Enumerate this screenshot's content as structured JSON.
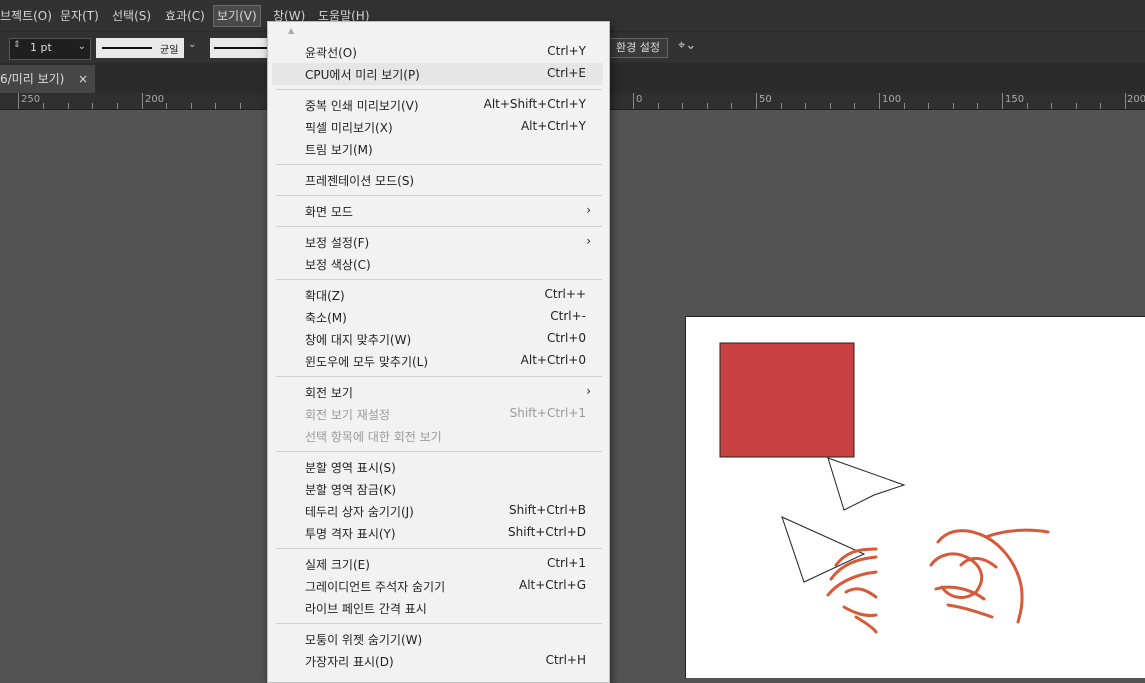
{
  "menubar": {
    "items": [
      "브젝트(O)",
      "문자(T)",
      "선택(S)",
      "효과(C)",
      "보기(V)",
      "창(W)",
      "도움말(H)"
    ]
  },
  "toolbar": {
    "stroke_weight": "1 pt",
    "stroke_profile": "균일",
    "preferences_button": "환경 설정"
  },
  "document_tab": {
    "title": "6/미리 보기)",
    "close": "×"
  },
  "ruler": {
    "labels": [
      "250",
      "200",
      "0",
      "50",
      "100",
      "150",
      "200"
    ]
  },
  "view_menu": {
    "sections": [
      [
        {
          "label": "윤곽선(O)",
          "shortcut": "Ctrl+Y"
        },
        {
          "label": "CPU에서 미리 보기(P)",
          "shortcut": "Ctrl+E",
          "highlighted": true
        }
      ],
      [
        {
          "label": "중복 인쇄 미리보기(V)",
          "shortcut": "Alt+Shift+Ctrl+Y"
        },
        {
          "label": "픽셀 미리보기(X)",
          "shortcut": "Alt+Ctrl+Y"
        },
        {
          "label": "트림 보기(M)",
          "shortcut": ""
        }
      ],
      [
        {
          "label": "프레젠테이션 모드(S)",
          "shortcut": ""
        }
      ],
      [
        {
          "label": "화면 모드",
          "shortcut": "",
          "submenu": true
        }
      ],
      [
        {
          "label": "보정 설정(F)",
          "shortcut": "",
          "submenu": true
        },
        {
          "label": "보정 색상(C)",
          "shortcut": ""
        }
      ],
      [
        {
          "label": "확대(Z)",
          "shortcut": "Ctrl++"
        },
        {
          "label": "축소(M)",
          "shortcut": "Ctrl+-"
        },
        {
          "label": "창에 대지 맞추기(W)",
          "shortcut": "Ctrl+0"
        },
        {
          "label": "윈도우에 모두 맞추기(L)",
          "shortcut": "Alt+Ctrl+0"
        }
      ],
      [
        {
          "label": "회전 보기",
          "shortcut": "",
          "submenu": true
        },
        {
          "label": "회전 보기 재설정",
          "shortcut": "Shift+Ctrl+1",
          "disabled": true
        },
        {
          "label": "선택 항목에 대한 회전 보기",
          "shortcut": "",
          "disabled": true
        }
      ],
      [
        {
          "label": "분할 영역 표시(S)",
          "shortcut": ""
        },
        {
          "label": "분할 영역 잠금(K)",
          "shortcut": ""
        },
        {
          "label": "테두리 상자 숨기기(J)",
          "shortcut": "Shift+Ctrl+B"
        },
        {
          "label": "투명 격자 표시(Y)",
          "shortcut": "Shift+Ctrl+D"
        }
      ],
      [
        {
          "label": "실제 크기(E)",
          "shortcut": "Ctrl+1"
        },
        {
          "label": "그레이디언트 주석자 숨기기",
          "shortcut": "Alt+Ctrl+G"
        },
        {
          "label": "라이브 페인트 간격 표시",
          "shortcut": ""
        }
      ],
      [
        {
          "label": "모퉁이 위젯 숨기기(W)",
          "shortcut": ""
        },
        {
          "label": "가장자리 표시(D)",
          "shortcut": "Ctrl+H"
        }
      ]
    ]
  },
  "colors": {
    "red_square": "#c94141",
    "scribble": "#d65a3a",
    "menu_bg": "#f2f2f2",
    "app_bg": "#535353"
  }
}
